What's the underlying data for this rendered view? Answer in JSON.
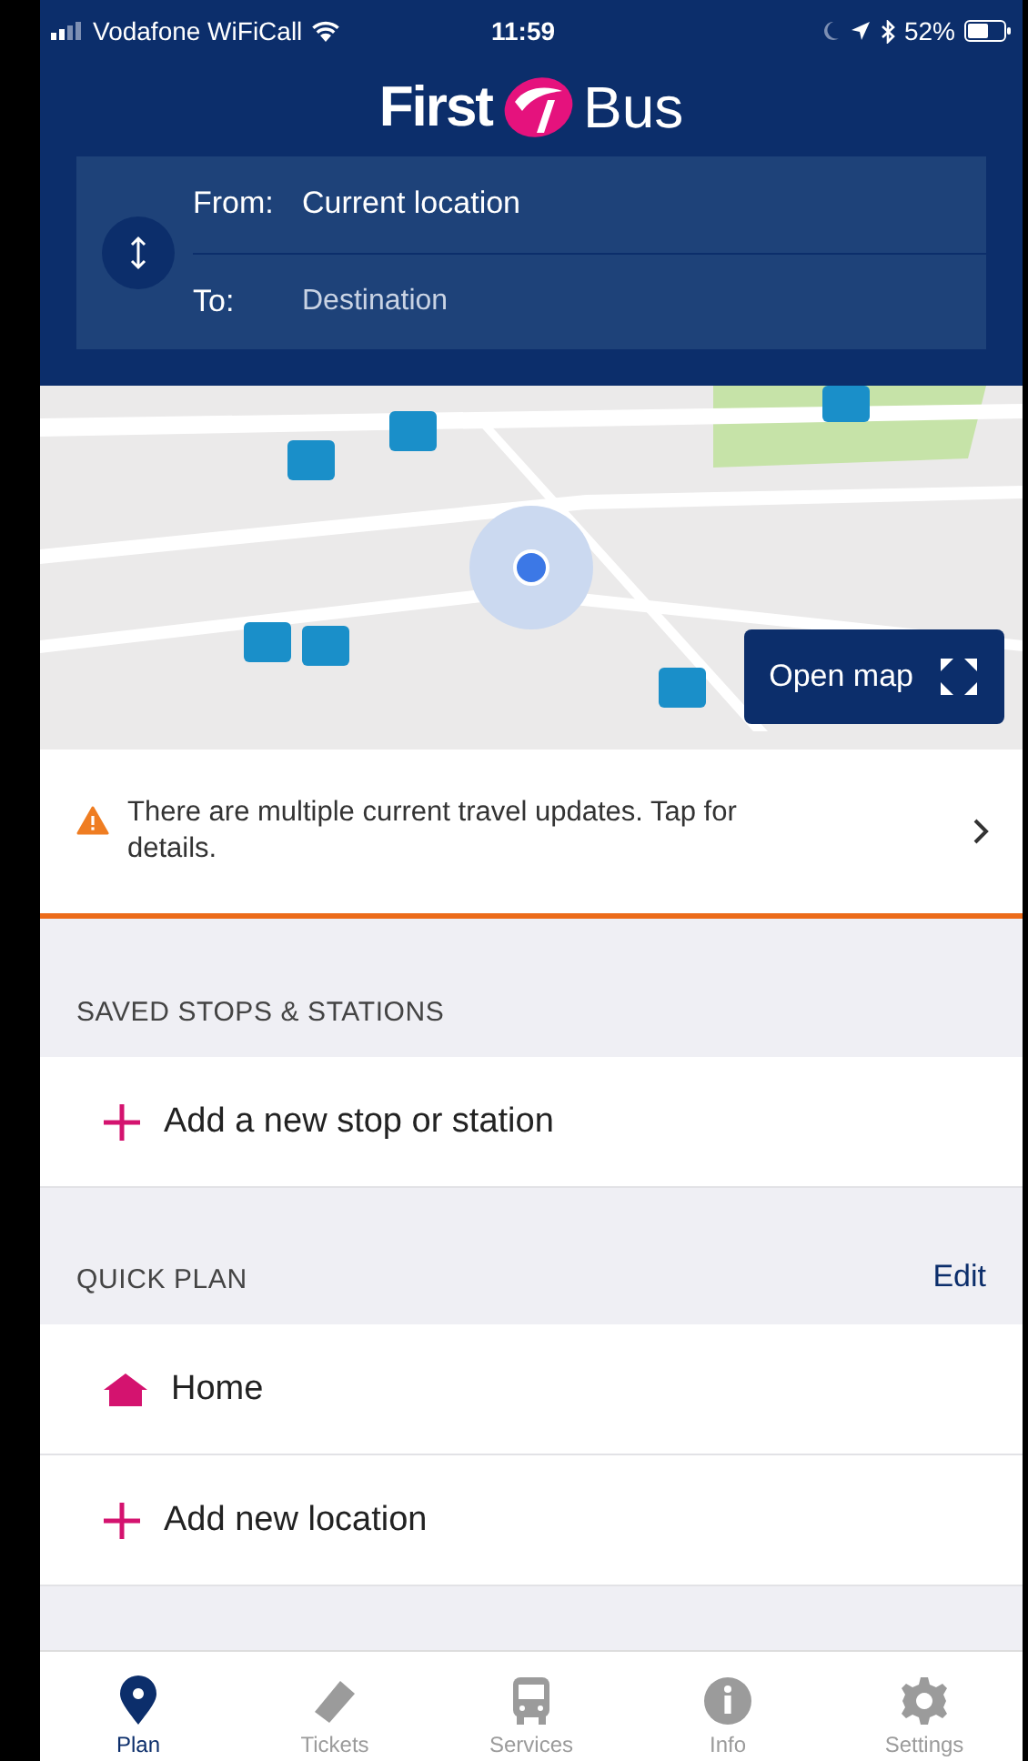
{
  "status_bar": {
    "carrier": "Vodafone WiFiCall",
    "time": "11:59",
    "battery": "52%"
  },
  "logo": {
    "first": "First",
    "second": "Bus"
  },
  "journey": {
    "from_label": "From:",
    "from_value": "Current location",
    "to_label": "To:",
    "to_placeholder": "Destination"
  },
  "map": {
    "kind": "picture",
    "button": "Open map"
  },
  "alert": {
    "text": "There are multiple current travel updates. Tap for details."
  },
  "saved": {
    "title": "SAVED STOPS & STATIONS",
    "add": "Add a new stop or station"
  },
  "quick_plan": {
    "title": "QUICK PLAN",
    "action": "Edit",
    "items": [
      {
        "kind": "home",
        "label": "Home"
      },
      {
        "kind": "add",
        "label": "Add new location"
      }
    ]
  },
  "tabs": [
    {
      "kind": "pin",
      "label": "Plan",
      "selected": true
    },
    {
      "kind": "ticket",
      "label": "Tickets",
      "selected": false
    },
    {
      "kind": "bus",
      "label": "Services",
      "selected": false
    },
    {
      "kind": "info",
      "label": "Info",
      "selected": false
    },
    {
      "kind": "gear",
      "label": "Settings",
      "selected": false
    }
  ]
}
